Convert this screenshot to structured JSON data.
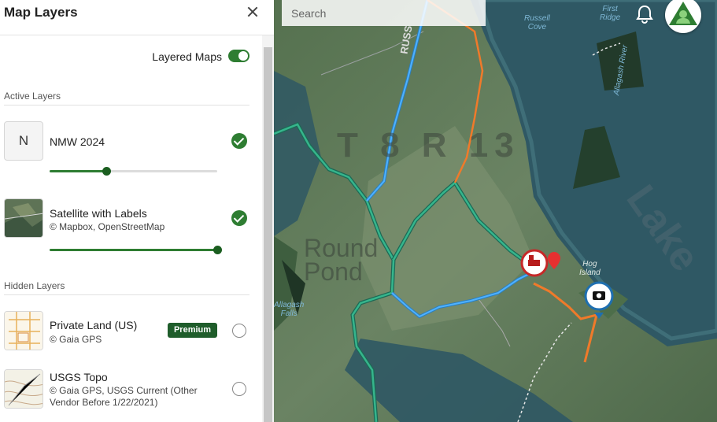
{
  "panel": {
    "title": "Map Layers",
    "layered_maps_label": "Layered Maps",
    "layered_maps_on": true,
    "active_section": "Active Layers",
    "hidden_section": "Hidden Layers",
    "active_layers": [
      {
        "name": "NMW 2024",
        "thumb_letter": "N",
        "attribution": "",
        "opacity": 0.34,
        "visible": true
      },
      {
        "name": "Satellite with Labels",
        "attribution": "© Mapbox, OpenStreetMap",
        "opacity": 1.0,
        "visible": true
      }
    ],
    "hidden_layers": [
      {
        "name": "Private Land (US)",
        "attribution": "© Gaia GPS",
        "badge": "Premium",
        "visible": false
      },
      {
        "name": "USGS Topo",
        "attribution": "© Gaia GPS, USGS Current (Other Vendor Before 1/22/2021)",
        "visible": false
      }
    ]
  },
  "map": {
    "search_placeholder": "Search",
    "labels": {
      "russell_cove": "Russell\nCove",
      "first_ridge": "First\nRidge",
      "allagash_river": "Allagash River",
      "lake": "Lake",
      "round_pond": "Round\nPond",
      "hog_island": "Hog\nIsland",
      "allagash_falls": "Allagash\nFalls",
      "t8r13": "T 8 R 13",
      "russell_road": "RUSS"
    },
    "colors": {
      "accent": "#2e7d32",
      "track_blue": "#3aa0e8",
      "track_orange": "#f07a2a",
      "track_green": "#2fa884"
    }
  }
}
